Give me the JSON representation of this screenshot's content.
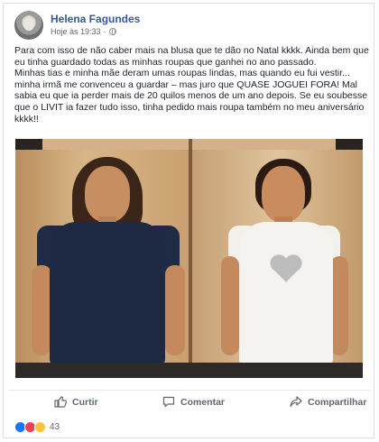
{
  "post": {
    "author": "Helena Fagundes",
    "timestamp": "Hoje às 19:33",
    "privacy_separator": "·",
    "privacy_icon": "globe-icon",
    "paragraphs": [
      "Para com isso de não caber mais na blusa que te dão no Natal kkkk. Ainda bem que eu tinha guardado todas as minhas roupas que ganhei no ano passado.",
      "Minhas tias e minha mãe deram umas roupas lindas, mas quando eu fui vestir... minha irmã me convenceu a guardar – mas juro que QUASE JOGUEI FORA! Mal sabia eu que ia perder mais de 20 quilos menos de um ano depois. Se eu soubesse que o LIVIT ia fazer tudo isso, tinha pedido mais roupa também no meu aniversário kkkk!!"
    ]
  },
  "actions": {
    "like_label": "Curtir",
    "comment_label": "Comentar",
    "share_label": "Compartilhar"
  },
  "reactions": {
    "icons": [
      "like-reaction-icon",
      "love-reaction-icon",
      "wow-reaction-icon"
    ],
    "count": "43"
  },
  "colors": {
    "author_link": "#365899",
    "text": "#1d2129",
    "muted": "#606770",
    "like_blue": "#1877f2",
    "love_red": "#f33e58",
    "wow_yellow": "#fcc13d"
  }
}
